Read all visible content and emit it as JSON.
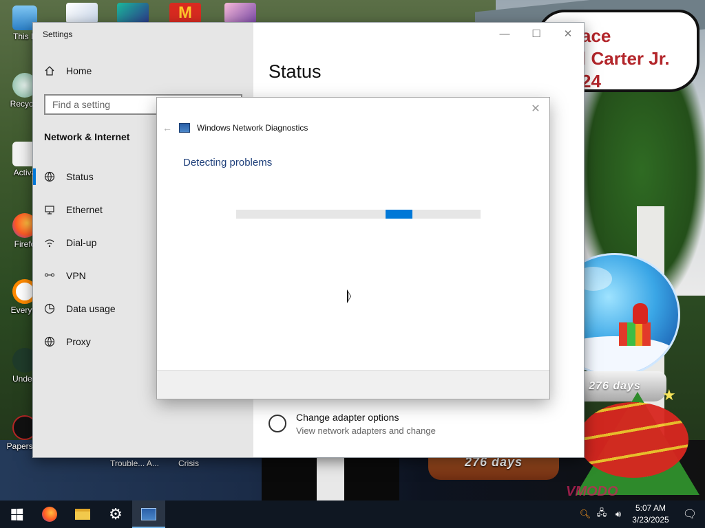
{
  "wallpaper": {
    "bubble_lines": [
      "ace",
      "l Carter Jr.",
      "24"
    ],
    "globe_days_small": "276 days",
    "globe_days_large": "276 days",
    "watermark": "VMODO"
  },
  "desktop_icons": [
    {
      "label": "This P",
      "icon": "computer-icon"
    },
    {
      "label": "Recycle",
      "icon": "recycle-bin-icon"
    },
    {
      "label": "Activa",
      "icon": "activate-icon"
    },
    {
      "label": "Firefo",
      "icon": "firefox-icon"
    },
    {
      "label": "Everyth",
      "icon": "everything-search-icon"
    },
    {
      "label": "Undert",
      "icon": "undertale-icon"
    },
    {
      "label": "Papers, P",
      "icon": "papers-please-icon"
    }
  ],
  "taskbar_fragments": [
    "Trouble... A...",
    "Crisis"
  ],
  "settings": {
    "window_title": "Settings",
    "home_label": "Home",
    "search_placeholder": "Find a setting",
    "section_title": "Network & Internet",
    "nav_items": [
      {
        "label": "Status",
        "icon": "globe-icon",
        "active": true
      },
      {
        "label": "Ethernet",
        "icon": "ethernet-icon",
        "active": false
      },
      {
        "label": "Dial-up",
        "icon": "dialup-icon",
        "active": false
      },
      {
        "label": "VPN",
        "icon": "vpn-icon",
        "active": false
      },
      {
        "label": "Data usage",
        "icon": "data-usage-icon",
        "active": false
      },
      {
        "label": "Proxy",
        "icon": "globe-icon",
        "active": false
      }
    ],
    "page_title": "Status",
    "adapter_title": "Change adapter options",
    "adapter_sub": "View network adapters and change"
  },
  "diagnostics": {
    "title": "Windows Network Diagnostics",
    "heading": "Detecting problems",
    "progress": "indeterminate"
  },
  "taskbar": {
    "apps": [
      {
        "name": "start",
        "icon": "windows-logo-icon"
      },
      {
        "name": "firefox",
        "icon": "firefox-icon"
      },
      {
        "name": "file-explorer",
        "icon": "folder-icon"
      },
      {
        "name": "settings",
        "icon": "gear-icon"
      },
      {
        "name": "network-diagnostics",
        "icon": "network-diagnostics-icon",
        "active": true
      }
    ],
    "time": "5:07 AM",
    "date": "3/23/2025"
  },
  "colors": {
    "accent": "#0078d7",
    "heading_blue": "#1e3f7a",
    "taskbar": "#0f1722"
  }
}
